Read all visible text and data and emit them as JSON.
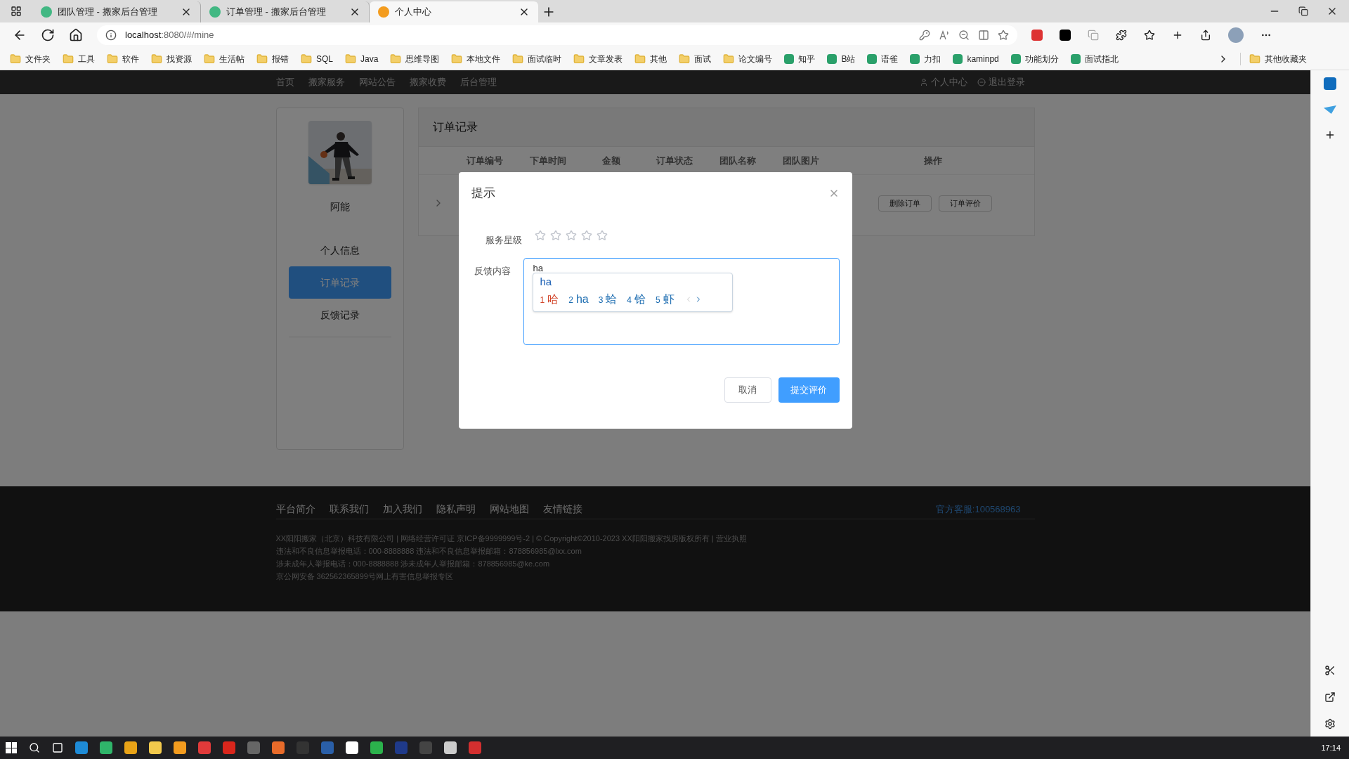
{
  "browser": {
    "tabs": [
      {
        "title": "团队管理 - 搬家后台管理",
        "selected": false
      },
      {
        "title": "订单管理 - 搬家后台管理",
        "selected": false
      },
      {
        "title": "个人中心",
        "selected": true
      }
    ],
    "address": {
      "host": "localhost",
      "rest": ":8080/#/mine"
    },
    "bookmarks": [
      {
        "label": "文件夹",
        "kind": "folder"
      },
      {
        "label": "工具",
        "kind": "folder"
      },
      {
        "label": "软件",
        "kind": "folder"
      },
      {
        "label": "找资源",
        "kind": "folder"
      },
      {
        "label": "生活帖",
        "kind": "folder"
      },
      {
        "label": "报错",
        "kind": "folder"
      },
      {
        "label": "SQL",
        "kind": "folder"
      },
      {
        "label": "Java",
        "kind": "folder"
      },
      {
        "label": "思维导图",
        "kind": "folder"
      },
      {
        "label": "本地文件",
        "kind": "folder"
      },
      {
        "label": "面试临时",
        "kind": "folder"
      },
      {
        "label": "文章发表",
        "kind": "folder"
      },
      {
        "label": "其他",
        "kind": "folder"
      },
      {
        "label": "面试",
        "kind": "folder"
      },
      {
        "label": "论文编号",
        "kind": "folder"
      },
      {
        "label": "知乎",
        "kind": "site"
      },
      {
        "label": "B站",
        "kind": "site"
      },
      {
        "label": "语雀",
        "kind": "site"
      },
      {
        "label": "力扣",
        "kind": "site"
      },
      {
        "label": "kaminpd",
        "kind": "site"
      },
      {
        "label": "功能划分",
        "kind": "site"
      },
      {
        "label": "面试指北",
        "kind": "site"
      }
    ],
    "other_bookmarks": "其他收藏夹"
  },
  "nav": {
    "items": [
      "首页",
      "搬家服务",
      "网站公告",
      "搬家收费",
      "后台管理"
    ],
    "user": "个人中心",
    "logout": "退出登录"
  },
  "sidebar": {
    "name": "阿能",
    "items": [
      {
        "label": "个人信息",
        "selected": false
      },
      {
        "label": "订单记录",
        "selected": true
      },
      {
        "label": "反馈记录",
        "selected": false
      }
    ]
  },
  "orders": {
    "title": "订单记录",
    "columns": [
      "订单编号",
      "下单时间",
      "金额",
      "订单状态",
      "团队名称",
      "团队图片",
      "操作"
    ],
    "actions": [
      "删除订单",
      "订单评价"
    ]
  },
  "dialog": {
    "title": "提示",
    "rating_label": "服务星级",
    "stars": 0,
    "feedback_label": "反馈内容",
    "feedback_value": "ha",
    "ime": {
      "composition": "ha",
      "candidates": [
        {
          "index": "1",
          "text": "哈",
          "selected": true
        },
        {
          "index": "2",
          "text": "ha",
          "selected": false
        },
        {
          "index": "3",
          "text": "蛤",
          "selected": false
        },
        {
          "index": "4",
          "text": "铪",
          "selected": false
        },
        {
          "index": "5",
          "text": "虾",
          "selected": false
        }
      ]
    },
    "buttons": {
      "cancel": "取消",
      "submit": "提交评价"
    }
  },
  "footer": {
    "links": [
      "平台简介",
      "联系我们",
      "加入我们",
      "隐私声明",
      "网站地图",
      "友情链接"
    ],
    "hotline": "官方客服:100568963",
    "lines": [
      "XX阳阳搬家（北京）科技有限公司 | 网络经营许可证 京ICP备9999999号-2 | © Copyright©2010-2023 XX阳阳搬家找房版权所有 | 营业执照",
      "违法和不良信息举报电话：000-8888888 违法和不良信息举报邮箱：878856985@lxx.com",
      "涉未成年人举报电话：000-8888888 涉未成年人举报邮箱：878856985@ke.com",
      "京公网安备 362562365899号网上有害信息举报专区"
    ]
  },
  "taskbar": {
    "time": "17:14"
  }
}
